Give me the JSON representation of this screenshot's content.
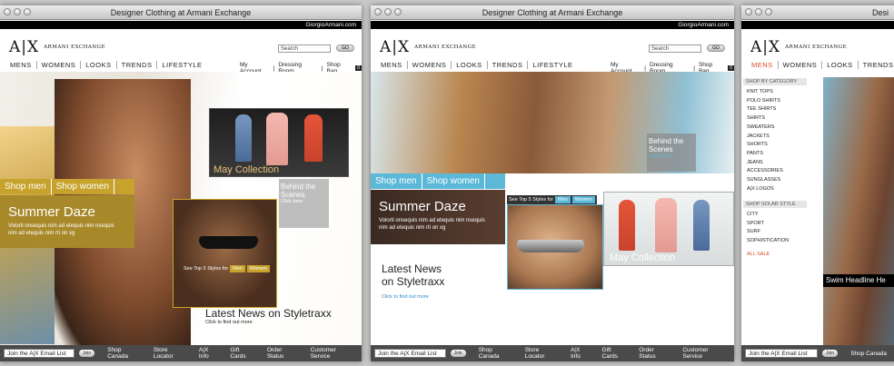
{
  "window_title": "Designer Clothing at Armani Exchange",
  "site_link": "GiorgioArmani.com",
  "logo_mark": "A|X",
  "logo_text": "ARMANI EXCHANGE",
  "search_placeholder": "Search",
  "go_label": "GO",
  "nav": [
    "MENS",
    "WOMENS",
    "LOOKS",
    "TRENDS",
    "LIFESTYLE"
  ],
  "util": {
    "account": "My Account",
    "dressing": "Dressing Room",
    "bag": "Shop Bag",
    "bag_count": "0"
  },
  "shop_men": "Shop men",
  "shop_women": "Shop women",
  "summer_daze": "Summer Daze",
  "summer_text": "Volorti onsequis nim ad etequis nim nsequis nim ad etequis nim rti on xg",
  "collection": "May Collection",
  "behind": "Behind the Scenes",
  "click_here": "Click here",
  "top5": "See Top 5 Styles for",
  "men": "Men",
  "women": "Women",
  "news1": "Latest News on Styletraxx",
  "news2_line1": "Latest News",
  "news2_line2": "on Styletraxx",
  "find_out": "Click to find out more",
  "footer": {
    "email": "Join the A|X Email List",
    "join": "Join",
    "links": [
      "Shop Canada",
      "Store Locator",
      "A|X Info",
      "Gift Cards",
      "Order Status",
      "Customer Service"
    ]
  },
  "categories_title": "SHOP BY CATEGORY",
  "categories": [
    "KNIT TOPS",
    "POLO SHIRTS",
    "TEE SHIRTS",
    "SHIRTS",
    "SWEATERS",
    "JACKETS",
    "SHORTS",
    "PANTS",
    "JEANS",
    "ACCESSORIES",
    "SUNGLASSES",
    "A|X LOGOS"
  ],
  "solar_title": "SHOP SOLAR STYLE",
  "solar": [
    "CITY",
    "SPORT",
    "SURF",
    "SOPHISTICATION"
  ],
  "all_sale": "ALL SALE",
  "swim": "Swim Headline He",
  "third_title": "Desi",
  "colors": {
    "gold": "#c7a32d",
    "blue": "#5bb8d8",
    "sale": "#d84b20"
  }
}
